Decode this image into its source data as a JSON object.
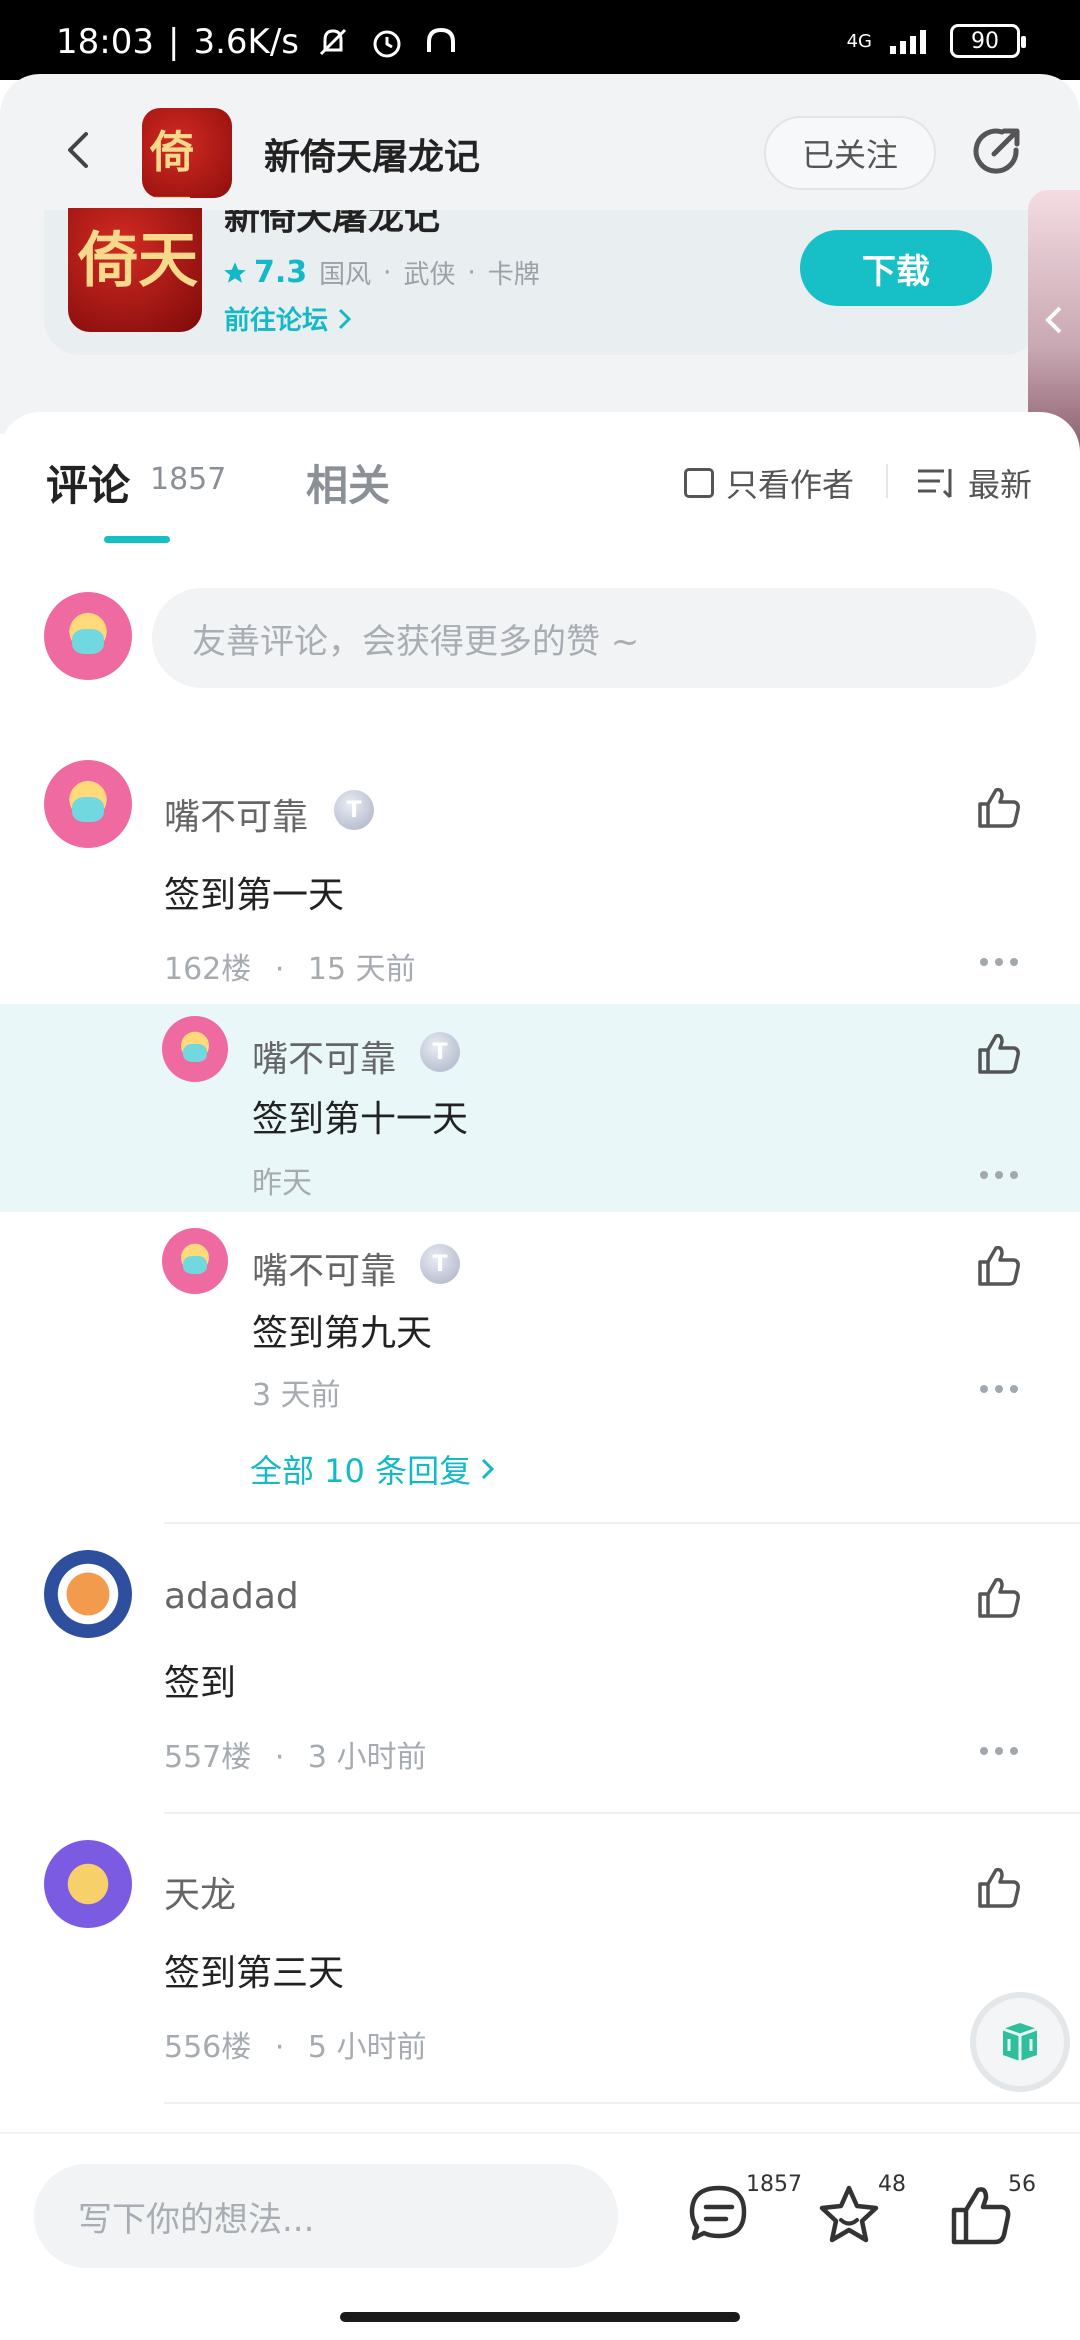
{
  "status_bar": {
    "time": "18:03",
    "net_speed": "3.6K/s",
    "signal": "4G",
    "battery": "90"
  },
  "header": {
    "title": "新倚天屠龙记",
    "follow_label": "已关注",
    "app_icon_text": "倚天"
  },
  "app_card": {
    "title": "新倚天屠龙记",
    "rating": "7.3",
    "tags": [
      "国风",
      "武侠",
      "卡牌"
    ],
    "tag_separator": "·",
    "forum_link": "前往论坛",
    "download_label": "下载"
  },
  "tabs": {
    "comments_label": "评论",
    "comments_count": "1857",
    "related_label": "相关",
    "only_author_label": "只看作者",
    "sort_label": "最新"
  },
  "comment_input": {
    "placeholder": "友善评论，会获得更多的赞 ~"
  },
  "comments": [
    {
      "username": "嘴不可靠",
      "badge": "T",
      "text": "签到第一天",
      "floor": "162楼",
      "time": "15 天前",
      "replies": [
        {
          "username": "嘴不可靠",
          "badge": "T",
          "text": "签到第十一天",
          "time": "昨天"
        },
        {
          "username": "嘴不可靠",
          "badge": "T",
          "text": "签到第九天",
          "time": "3 天前"
        }
      ],
      "all_replies_label": "全部 10 条回复"
    },
    {
      "username": "adadad",
      "text": "签到",
      "floor": "557楼",
      "time": "3 小时前"
    },
    {
      "username": "天龙",
      "text": "签到第三天",
      "floor": "556楼",
      "time": "5 小时前"
    }
  ],
  "meta_separator": "·",
  "bottom_bar": {
    "placeholder": "写下你的想法...",
    "comment_count": "1857",
    "favorite_count": "48",
    "like_count": "56"
  },
  "colors": {
    "accent": "#16c0c6",
    "highlight": "#e9f7f8",
    "background": "#ffffff"
  }
}
